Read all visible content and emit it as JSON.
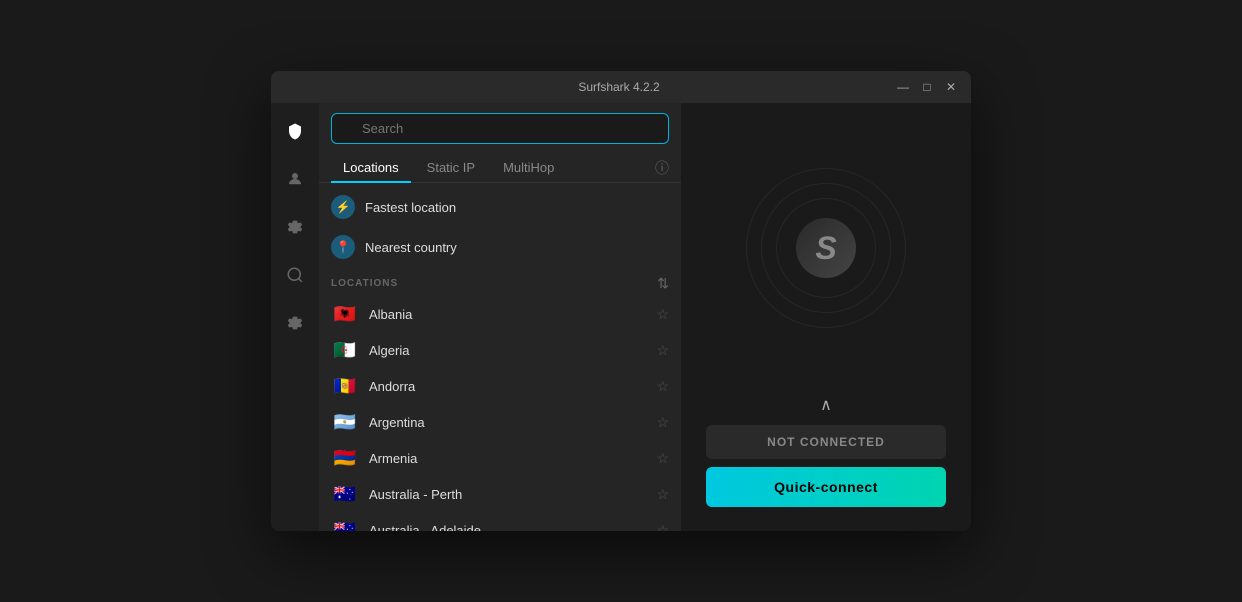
{
  "app": {
    "title": "Surfshark 4.2.2",
    "window_controls": {
      "minimize": "—",
      "maximize": "□",
      "close": "✕"
    }
  },
  "sidebar": {
    "icons": [
      {
        "name": "shield-icon",
        "symbol": "🛡",
        "active": true
      },
      {
        "name": "person-icon",
        "symbol": "👤",
        "active": false
      },
      {
        "name": "settings-icon",
        "symbol": "⚙",
        "active": false
      },
      {
        "name": "search-vpn-icon",
        "symbol": "🔍",
        "active": false
      },
      {
        "name": "gear-icon",
        "symbol": "⚙",
        "active": false
      }
    ]
  },
  "search": {
    "placeholder": "Search"
  },
  "tabs": [
    {
      "label": "Locations",
      "active": true
    },
    {
      "label": "Static IP",
      "active": false
    },
    {
      "label": "MultiHop",
      "active": false
    }
  ],
  "quick_items": [
    {
      "label": "Fastest location",
      "icon_type": "fastest",
      "icon_symbol": "⚡"
    },
    {
      "label": "Nearest country",
      "icon_type": "nearest",
      "icon_symbol": "📍"
    }
  ],
  "locations_section": {
    "label": "LOCATIONS",
    "sort_icon": "↻"
  },
  "countries": [
    {
      "name": "Albania",
      "flag": "🇦🇱"
    },
    {
      "name": "Algeria",
      "flag": "🇩🇿"
    },
    {
      "name": "Andorra",
      "flag": "🇦🇩"
    },
    {
      "name": "Argentina",
      "flag": "🇦🇷"
    },
    {
      "name": "Armenia",
      "flag": "🇦🇲"
    },
    {
      "name": "Australia - Perth",
      "flag": "🇦🇺"
    },
    {
      "name": "Australia - Adelaide",
      "flag": "🇦🇺"
    }
  ],
  "right_panel": {
    "logo_letter": "S",
    "expand_icon": "∧",
    "status": "NOT CONNECTED",
    "quick_connect_label": "Quick-connect"
  }
}
